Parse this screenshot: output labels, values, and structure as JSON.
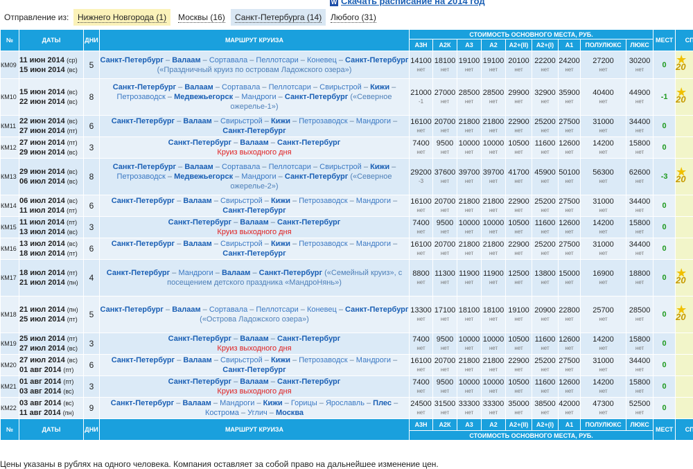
{
  "top_link": {
    "icon": "word-doc-icon",
    "text": "Скачать расписание на 2014 год"
  },
  "filters": {
    "label": "Отправление из:",
    "tabs": [
      "Нижнего Новгорода (1)",
      "Москвы (16)",
      "Санкт-Петербурга (14)",
      "Любого (31)"
    ]
  },
  "header": {
    "num": "№",
    "dates": "ДАТЫ",
    "days": "ДНИ",
    "route": "МАРШРУТ КРУИЗА",
    "cost_title": "СТОИМОСТЬ ОСНОВНОГО МЕСТА, РУБ.",
    "classes": [
      "А3Н",
      "А2К",
      "А3",
      "А2",
      "А2+(II)",
      "А2+(I)",
      "А1",
      "ПОЛУЛЮКС",
      "ЛЮКС"
    ],
    "seats": "МЕСТ",
    "promo": "СП ПР"
  },
  "rows": [
    {
      "code": "КМ09",
      "d1": "11 июн 2014",
      "w1": "(ср)",
      "d2": "15 июн 2014",
      "w2": "(вс)",
      "days": "5",
      "route": [
        [
          "c",
          "Санкт-Петербург"
        ],
        [
          "s",
          " – "
        ],
        [
          "c",
          "Валаам"
        ],
        [
          "s",
          " – "
        ],
        [
          "p",
          "Сортавала"
        ],
        [
          "s",
          " – "
        ],
        [
          "p",
          "Пеллотсари"
        ],
        [
          "s",
          " – "
        ],
        [
          "p",
          "Коневец"
        ],
        [
          "s",
          " – "
        ],
        [
          "c",
          "Санкт-Петербург"
        ],
        [
          "n",
          " («Праздничный круиз по островам Ладожского озера»)"
        ]
      ],
      "prices": [
        "14100",
        "18100",
        "19100",
        "19100",
        "20100",
        "22200",
        "24200",
        "27200",
        "30200"
      ],
      "subs": [
        "нет",
        "нет",
        "нет",
        "нет",
        "нет",
        "нет",
        "нет",
        "нет",
        "нет"
      ],
      "seats": "0",
      "promo": "20"
    },
    {
      "code": "КМ10",
      "d1": "15 июн 2014",
      "w1": "(вс)",
      "d2": "22 июн 2014",
      "w2": "(вс)",
      "days": "8",
      "route": [
        [
          "c",
          "Санкт-Петербург"
        ],
        [
          "s",
          " – "
        ],
        [
          "c",
          "Валаам"
        ],
        [
          "s",
          " – "
        ],
        [
          "p",
          "Сортавала"
        ],
        [
          "s",
          " – "
        ],
        [
          "p",
          "Пеллотсари"
        ],
        [
          "s",
          " – "
        ],
        [
          "p",
          "Свирьстрой"
        ],
        [
          "s",
          " – "
        ],
        [
          "c",
          "Кижи"
        ],
        [
          "s",
          " – "
        ],
        [
          "p",
          "Петрозаводск"
        ],
        [
          "s",
          " – "
        ],
        [
          "c",
          "Медвежьегорск"
        ],
        [
          "s",
          " – "
        ],
        [
          "p",
          "Мандроги"
        ],
        [
          "s",
          " – "
        ],
        [
          "c",
          "Санкт-Петербург"
        ],
        [
          "n",
          " («Северное ожерелье-1»)"
        ]
      ],
      "prices": [
        "21000",
        "27000",
        "28500",
        "28500",
        "29900",
        "32900",
        "35900",
        "40400",
        "44900"
      ],
      "subs": [
        "-1",
        "нет",
        "нет",
        "нет",
        "нет",
        "нет",
        "нет",
        "нет",
        "нет"
      ],
      "seats": "-1",
      "promo": "20"
    },
    {
      "code": "КМ11",
      "d1": "22 июн 2014",
      "w1": "(вс)",
      "d2": "27 июн 2014",
      "w2": "(пт)",
      "days": "6",
      "route": [
        [
          "c",
          "Санкт-Петербург"
        ],
        [
          "s",
          " – "
        ],
        [
          "c",
          "Валаам"
        ],
        [
          "s",
          " – "
        ],
        [
          "p",
          "Свирьстрой"
        ],
        [
          "s",
          " – "
        ],
        [
          "c",
          "Кижи"
        ],
        [
          "s",
          " – "
        ],
        [
          "p",
          "Петрозаводск"
        ],
        [
          "s",
          " – "
        ],
        [
          "p",
          "Мандроги"
        ],
        [
          "s",
          " – "
        ],
        [
          "c",
          "Санкт-Петербург"
        ]
      ],
      "prices": [
        "16100",
        "20700",
        "21800",
        "21800",
        "22900",
        "25200",
        "27500",
        "31000",
        "34400"
      ],
      "subs": [
        "нет",
        "нет",
        "нет",
        "нет",
        "нет",
        "нет",
        "нет",
        "нет",
        "нет"
      ],
      "seats": "0",
      "promo": ""
    },
    {
      "code": "КМ12",
      "d1": "27 июн 2014",
      "w1": "(пт)",
      "d2": "29 июн 2014",
      "w2": "(вс)",
      "days": "3",
      "route": [
        [
          "c",
          "Санкт-Петербург"
        ],
        [
          "s",
          " – "
        ],
        [
          "c",
          "Валаам"
        ],
        [
          "s",
          " – "
        ],
        [
          "c",
          "Санкт-Петербург"
        ],
        [
          "r",
          "Круиз выходного дня"
        ]
      ],
      "prices": [
        "7400",
        "9500",
        "10000",
        "10000",
        "10500",
        "11600",
        "12600",
        "14200",
        "15800"
      ],
      "subs": [
        "нет",
        "нет",
        "нет",
        "нет",
        "нет",
        "нет",
        "нет",
        "нет",
        "нет"
      ],
      "seats": "0",
      "promo": ""
    },
    {
      "code": "КМ13",
      "d1": "29 июн 2014",
      "w1": "(вс)",
      "d2": "06 июл 2014",
      "w2": "(вс)",
      "days": "8",
      "route": [
        [
          "c",
          "Санкт-Петербург"
        ],
        [
          "s",
          " – "
        ],
        [
          "c",
          "Валаам"
        ],
        [
          "s",
          " – "
        ],
        [
          "p",
          "Сортавала"
        ],
        [
          "s",
          " – "
        ],
        [
          "p",
          "Пеллотсари"
        ],
        [
          "s",
          " – "
        ],
        [
          "p",
          "Свирьстрой"
        ],
        [
          "s",
          " – "
        ],
        [
          "c",
          "Кижи"
        ],
        [
          "s",
          " – "
        ],
        [
          "p",
          "Петрозаводск"
        ],
        [
          "s",
          " – "
        ],
        [
          "c",
          "Медвежьегорск"
        ],
        [
          "s",
          " – "
        ],
        [
          "p",
          "Мандроги"
        ],
        [
          "s",
          " – "
        ],
        [
          "c",
          "Санкт-Петербург"
        ],
        [
          "n",
          " («Северное ожерелье-2»)"
        ]
      ],
      "prices": [
        "29200",
        "37600",
        "39700",
        "39700",
        "41700",
        "45900",
        "50100",
        "56300",
        "62600"
      ],
      "subs": [
        "-3",
        "нет",
        "нет",
        "нет",
        "нет",
        "нет",
        "нет",
        "нет",
        "нет"
      ],
      "seats": "-3",
      "promo": "20"
    },
    {
      "code": "КМ14",
      "d1": "06 июл 2014",
      "w1": "(вс)",
      "d2": "11 июл 2014",
      "w2": "(пт)",
      "days": "6",
      "route": [
        [
          "c",
          "Санкт-Петербург"
        ],
        [
          "s",
          " – "
        ],
        [
          "c",
          "Валаам"
        ],
        [
          "s",
          " – "
        ],
        [
          "p",
          "Свирьстрой"
        ],
        [
          "s",
          " – "
        ],
        [
          "c",
          "Кижи"
        ],
        [
          "s",
          " – "
        ],
        [
          "p",
          "Петрозаводск"
        ],
        [
          "s",
          " – "
        ],
        [
          "p",
          "Мандроги"
        ],
        [
          "s",
          " – "
        ],
        [
          "c",
          "Санкт-Петербург"
        ]
      ],
      "prices": [
        "16100",
        "20700",
        "21800",
        "21800",
        "22900",
        "25200",
        "27500",
        "31000",
        "34400"
      ],
      "subs": [
        "нет",
        "нет",
        "нет",
        "нет",
        "нет",
        "нет",
        "нет",
        "нет",
        "нет"
      ],
      "seats": "0",
      "promo": ""
    },
    {
      "code": "КМ15",
      "d1": "11 июл 2014",
      "w1": "(пт)",
      "d2": "13 июл 2014",
      "w2": "(вс)",
      "days": "3",
      "route": [
        [
          "c",
          "Санкт-Петербург"
        ],
        [
          "s",
          " – "
        ],
        [
          "c",
          "Валаам"
        ],
        [
          "s",
          " – "
        ],
        [
          "c",
          "Санкт-Петербург"
        ],
        [
          "r",
          "Круиз выходного дня"
        ]
      ],
      "prices": [
        "7400",
        "9500",
        "10000",
        "10000",
        "10500",
        "11600",
        "12600",
        "14200",
        "15800"
      ],
      "subs": [
        "нет",
        "нет",
        "нет",
        "нет",
        "нет",
        "нет",
        "нет",
        "нет",
        "нет"
      ],
      "seats": "0",
      "promo": ""
    },
    {
      "code": "КМ16",
      "d1": "13 июл 2014",
      "w1": "(вс)",
      "d2": "18 июл 2014",
      "w2": "(пт)",
      "days": "6",
      "route": [
        [
          "c",
          "Санкт-Петербург"
        ],
        [
          "s",
          " – "
        ],
        [
          "c",
          "Валаам"
        ],
        [
          "s",
          " – "
        ],
        [
          "p",
          "Свирьстрой"
        ],
        [
          "s",
          " – "
        ],
        [
          "c",
          "Кижи"
        ],
        [
          "s",
          " – "
        ],
        [
          "p",
          "Петрозаводск"
        ],
        [
          "s",
          " – "
        ],
        [
          "p",
          "Мандроги"
        ],
        [
          "s",
          " – "
        ],
        [
          "c",
          "Санкт-Петербург"
        ]
      ],
      "prices": [
        "16100",
        "20700",
        "21800",
        "21800",
        "22900",
        "25200",
        "27500",
        "31000",
        "34400"
      ],
      "subs": [
        "нет",
        "нет",
        "нет",
        "нет",
        "нет",
        "нет",
        "нет",
        "нет",
        "нет"
      ],
      "seats": "0",
      "promo": ""
    },
    {
      "code": "КМ17",
      "d1": "18 июл 2014",
      "w1": "(пт)",
      "d2": "21 июл 2014",
      "w2": "(пн)",
      "days": "4",
      "route": [
        [
          "c",
          "Санкт-Петербург"
        ],
        [
          "s",
          " – "
        ],
        [
          "p",
          "Мандроги"
        ],
        [
          "s",
          " – "
        ],
        [
          "c",
          "Валаам"
        ],
        [
          "s",
          " – "
        ],
        [
          "c",
          "Санкт-Петербург"
        ],
        [
          "n",
          " («Семейный круиз», с посещением детского праздника «МандроНянь»)"
        ]
      ],
      "prices": [
        "8800",
        "11300",
        "11900",
        "11900",
        "12500",
        "13800",
        "15000",
        "16900",
        "18800"
      ],
      "subs": [
        "нет",
        "нет",
        "нет",
        "нет",
        "нет",
        "нет",
        "нет",
        "нет",
        "нет"
      ],
      "seats": "0",
      "promo": "20"
    },
    {
      "code": "КМ18",
      "d1": "21 июл 2014",
      "w1": "(пн)",
      "d2": "25 июл 2014",
      "w2": "(пт)",
      "days": "5",
      "route": [
        [
          "c",
          "Санкт-Петербург"
        ],
        [
          "s",
          " – "
        ],
        [
          "c",
          "Валаам"
        ],
        [
          "s",
          " – "
        ],
        [
          "p",
          "Сортавала"
        ],
        [
          "s",
          " – "
        ],
        [
          "p",
          "Пеллотсари"
        ],
        [
          "s",
          " – "
        ],
        [
          "p",
          "Коневец"
        ],
        [
          "s",
          " – "
        ],
        [
          "c",
          "Санкт-Петербург"
        ],
        [
          "n",
          " («Острова Ладожского озера»)"
        ]
      ],
      "prices": [
        "13300",
        "17100",
        "18100",
        "18100",
        "19100",
        "20900",
        "22800",
        "25700",
        "28500"
      ],
      "subs": [
        "нет",
        "нет",
        "нет",
        "нет",
        "нет",
        "нет",
        "нет",
        "нет",
        "нет"
      ],
      "seats": "0",
      "promo": "20"
    },
    {
      "code": "КМ19",
      "d1": "25 июл 2014",
      "w1": "(пт)",
      "d2": "27 июл 2014",
      "w2": "(вс)",
      "days": "3",
      "route": [
        [
          "c",
          "Санкт-Петербург"
        ],
        [
          "s",
          " – "
        ],
        [
          "c",
          "Валаам"
        ],
        [
          "s",
          " – "
        ],
        [
          "c",
          "Санкт-Петербург"
        ],
        [
          "r",
          "Круиз выходного дня"
        ]
      ],
      "prices": [
        "7400",
        "9500",
        "10000",
        "10000",
        "10500",
        "11600",
        "12600",
        "14200",
        "15800"
      ],
      "subs": [
        "нет",
        "нет",
        "нет",
        "нет",
        "нет",
        "нет",
        "нет",
        "нет",
        "нет"
      ],
      "seats": "0",
      "promo": ""
    },
    {
      "code": "КМ20",
      "d1": "27 июл 2014",
      "w1": "(вс)",
      "d2": "01 авг 2014",
      "w2": "(пт)",
      "days": "6",
      "route": [
        [
          "c",
          "Санкт-Петербург"
        ],
        [
          "s",
          " – "
        ],
        [
          "c",
          "Валаам"
        ],
        [
          "s",
          " – "
        ],
        [
          "p",
          "Свирьстрой"
        ],
        [
          "s",
          " – "
        ],
        [
          "c",
          "Кижи"
        ],
        [
          "s",
          " – "
        ],
        [
          "p",
          "Петрозаводск"
        ],
        [
          "s",
          " – "
        ],
        [
          "p",
          "Мандроги"
        ],
        [
          "s",
          " – "
        ],
        [
          "c",
          "Санкт-Петербург"
        ]
      ],
      "prices": [
        "16100",
        "20700",
        "21800",
        "21800",
        "22900",
        "25200",
        "27500",
        "31000",
        "34400"
      ],
      "subs": [
        "нет",
        "нет",
        "нет",
        "нет",
        "нет",
        "нет",
        "нет",
        "нет",
        "нет"
      ],
      "seats": "0",
      "promo": ""
    },
    {
      "code": "КМ21",
      "d1": "01 авг 2014",
      "w1": "(пт)",
      "d2": "03 авг 2014",
      "w2": "(вс)",
      "days": "3",
      "route": [
        [
          "c",
          "Санкт-Петербург"
        ],
        [
          "s",
          " – "
        ],
        [
          "c",
          "Валаам"
        ],
        [
          "s",
          " – "
        ],
        [
          "c",
          "Санкт-Петербург"
        ],
        [
          "r",
          "Круиз выходного дня"
        ]
      ],
      "prices": [
        "7400",
        "9500",
        "10000",
        "10000",
        "10500",
        "11600",
        "12600",
        "14200",
        "15800"
      ],
      "subs": [
        "нет",
        "нет",
        "нет",
        "нет",
        "нет",
        "нет",
        "нет",
        "нет",
        "нет"
      ],
      "seats": "0",
      "promo": ""
    },
    {
      "code": "КМ22",
      "d1": "03 авг 2014",
      "w1": "(вс)",
      "d2": "11 авг 2014",
      "w2": "(пн)",
      "days": "9",
      "route": [
        [
          "c",
          "Санкт-Петербург"
        ],
        [
          "s",
          " – "
        ],
        [
          "c",
          "Валаам"
        ],
        [
          "s",
          " – "
        ],
        [
          "p",
          "Мандроги"
        ],
        [
          "s",
          " – "
        ],
        [
          "c",
          "Кижи"
        ],
        [
          "s",
          " – "
        ],
        [
          "p",
          "Горицы"
        ],
        [
          "s",
          " – "
        ],
        [
          "p",
          "Ярославль"
        ],
        [
          "s",
          " – "
        ],
        [
          "c",
          "Плес"
        ],
        [
          "s",
          " – "
        ],
        [
          "p",
          "Кострома"
        ],
        [
          "s",
          " – "
        ],
        [
          "p",
          "Углич"
        ],
        [
          "s",
          " – "
        ],
        [
          "c",
          "Москва"
        ]
      ],
      "prices": [
        "24500",
        "31500",
        "33300",
        "33300",
        "35000",
        "38500",
        "42000",
        "47300",
        "52500"
      ],
      "subs": [
        "нет",
        "нет",
        "нет",
        "нет",
        "нет",
        "нет",
        "нет",
        "нет",
        "нет"
      ],
      "seats": "0",
      "promo": ""
    }
  ],
  "footer_note": "Цены указаны в рублях на одного человека. Компания оставляет за собой право на дальнейшее изменение цен."
}
